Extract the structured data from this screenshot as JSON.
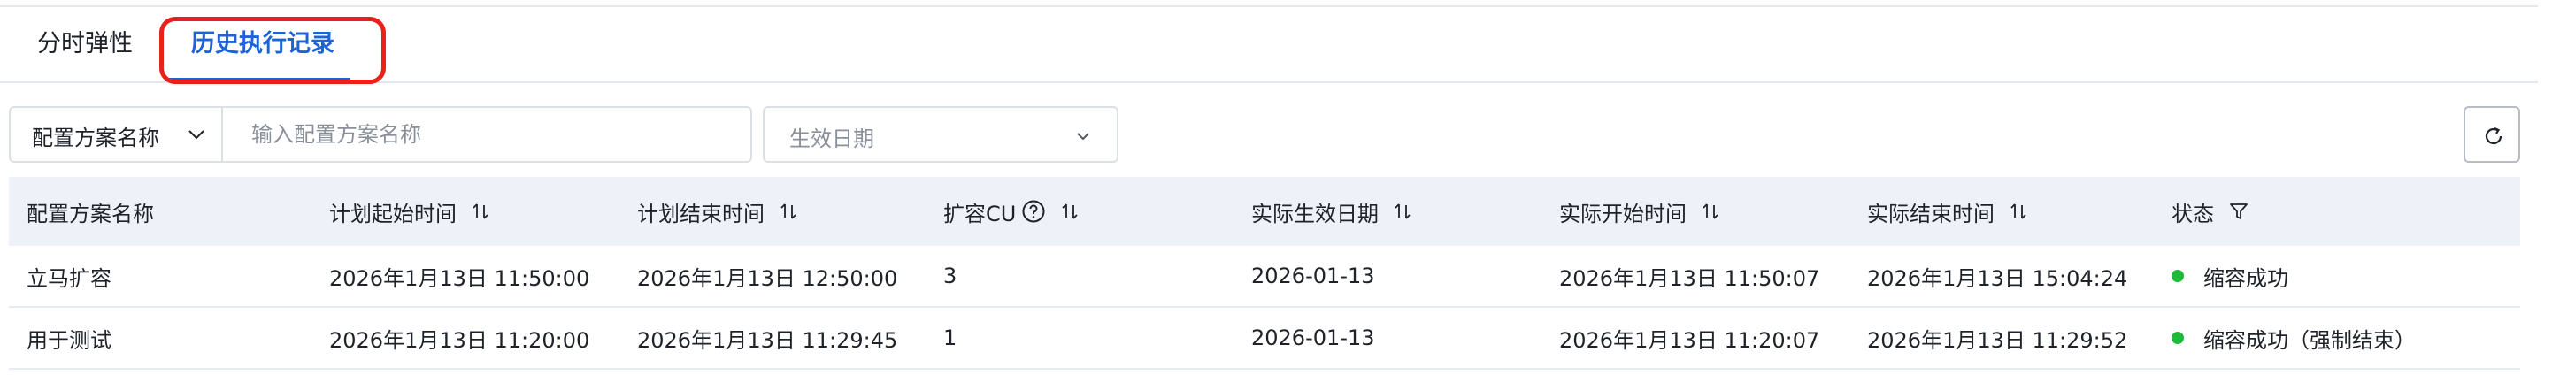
{
  "tabs": [
    {
      "label": "分时弹性",
      "active": false
    },
    {
      "label": "历史执行记录",
      "active": true
    }
  ],
  "filters": {
    "field_select_label": "配置方案名称",
    "search_placeholder": "输入配置方案名称",
    "search_value": "",
    "date_placeholder": "生效日期"
  },
  "table": {
    "headers": [
      "配置方案名称",
      "计划起始时间",
      "计划结束时间",
      "扩容CU",
      "实际生效日期",
      "实际开始时间",
      "实际结束时间",
      "状态"
    ],
    "rows": [
      {
        "name": "立马扩容",
        "plan_start": "2026年1月13日 11:50:00",
        "plan_end": "2026年1月13日 12:50:00",
        "cu": "3",
        "effective_date": "2026-01-13",
        "actual_start": "2026年1月13日 11:50:07",
        "actual_end": "2026年1月13日 15:04:24",
        "status": "缩容成功"
      },
      {
        "name": "用于测试",
        "plan_start": "2026年1月13日 11:20:00",
        "plan_end": "2026年1月13日 11:29:45",
        "cu": "1",
        "effective_date": "2026-01-13",
        "actual_start": "2026年1月13日 11:20:07",
        "actual_end": "2026年1月13日 11:29:52",
        "status": "缩容成功（强制结束）"
      }
    ]
  },
  "colors": {
    "accent": "#1d63d6",
    "highlight": "#e8221b",
    "status_success": "#1fb93b",
    "header_bg": "#eef1f8"
  },
  "icons": {
    "select_chevron": "chevron-down-icon",
    "date_chevron": "chevron-down-icon",
    "refresh": "refresh-icon",
    "sort": "sort-icon",
    "help": "question-circle-icon",
    "filter": "filter-icon",
    "status": "status-dot-icon"
  }
}
